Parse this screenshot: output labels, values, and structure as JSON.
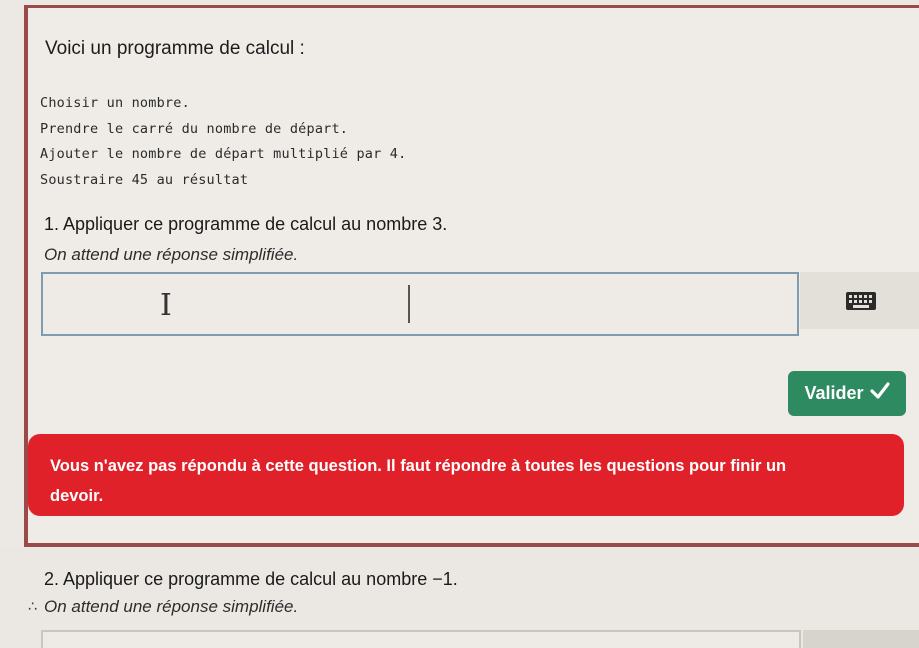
{
  "intro": "Voici un programme de calcul :",
  "program_lines": [
    "Choisir un nombre.",
    "Prendre le carré du nombre de départ.",
    "Ajouter le nombre de départ multiplié par 4.",
    "Soustraire 45 au résultat"
  ],
  "question1": {
    "title": "1. Appliquer ce programme de calcul au nombre 3.",
    "hint": "On attend une réponse simplifiée.",
    "answer_value": "",
    "keyboard_icon": "keyboard-icon",
    "validate_label": "Valider",
    "validate_icon": "checkmark-icon"
  },
  "error_message": {
    "line1": "Vous n'avez pas répondu à cette question. Il faut répondre à toutes les questions pour finir un",
    "line2": "devoir."
  },
  "question2": {
    "title": "2. Appliquer ce programme de calcul au nombre −1.",
    "hint": "On attend une réponse simplifiée."
  },
  "colors": {
    "validate_button": "#2e8b61",
    "error_background": "#e0212a",
    "card_border": "#9a4a49",
    "input_border": "#7e9bb0"
  }
}
